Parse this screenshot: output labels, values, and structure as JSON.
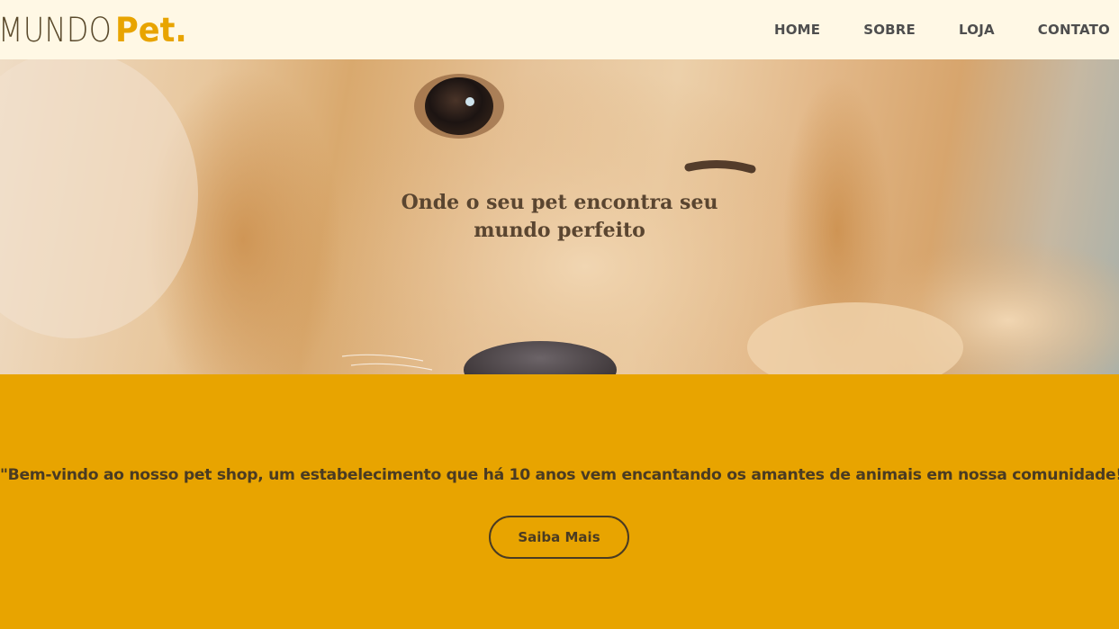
{
  "header": {
    "logo_mundo": "MUNDO",
    "logo_pet": "Pet.",
    "nav": [
      "HOME",
      "SOBRE",
      "LOJA",
      "CONTATO"
    ]
  },
  "hero": {
    "title": "Onde o seu pet encontra seu mundo perfeito",
    "image": "golden-retriever-puppy-photo"
  },
  "intro": {
    "text": "\"Bem-vindo ao nosso pet shop, um estabelecimento que há 10 anos vem encantando os amantes de animais em nossa comunidade!",
    "button_label": "Saiba Mais"
  },
  "colors": {
    "accent": "#e8a400",
    "header_bg": "#fff8e5",
    "text_dark": "#4a3b22"
  }
}
